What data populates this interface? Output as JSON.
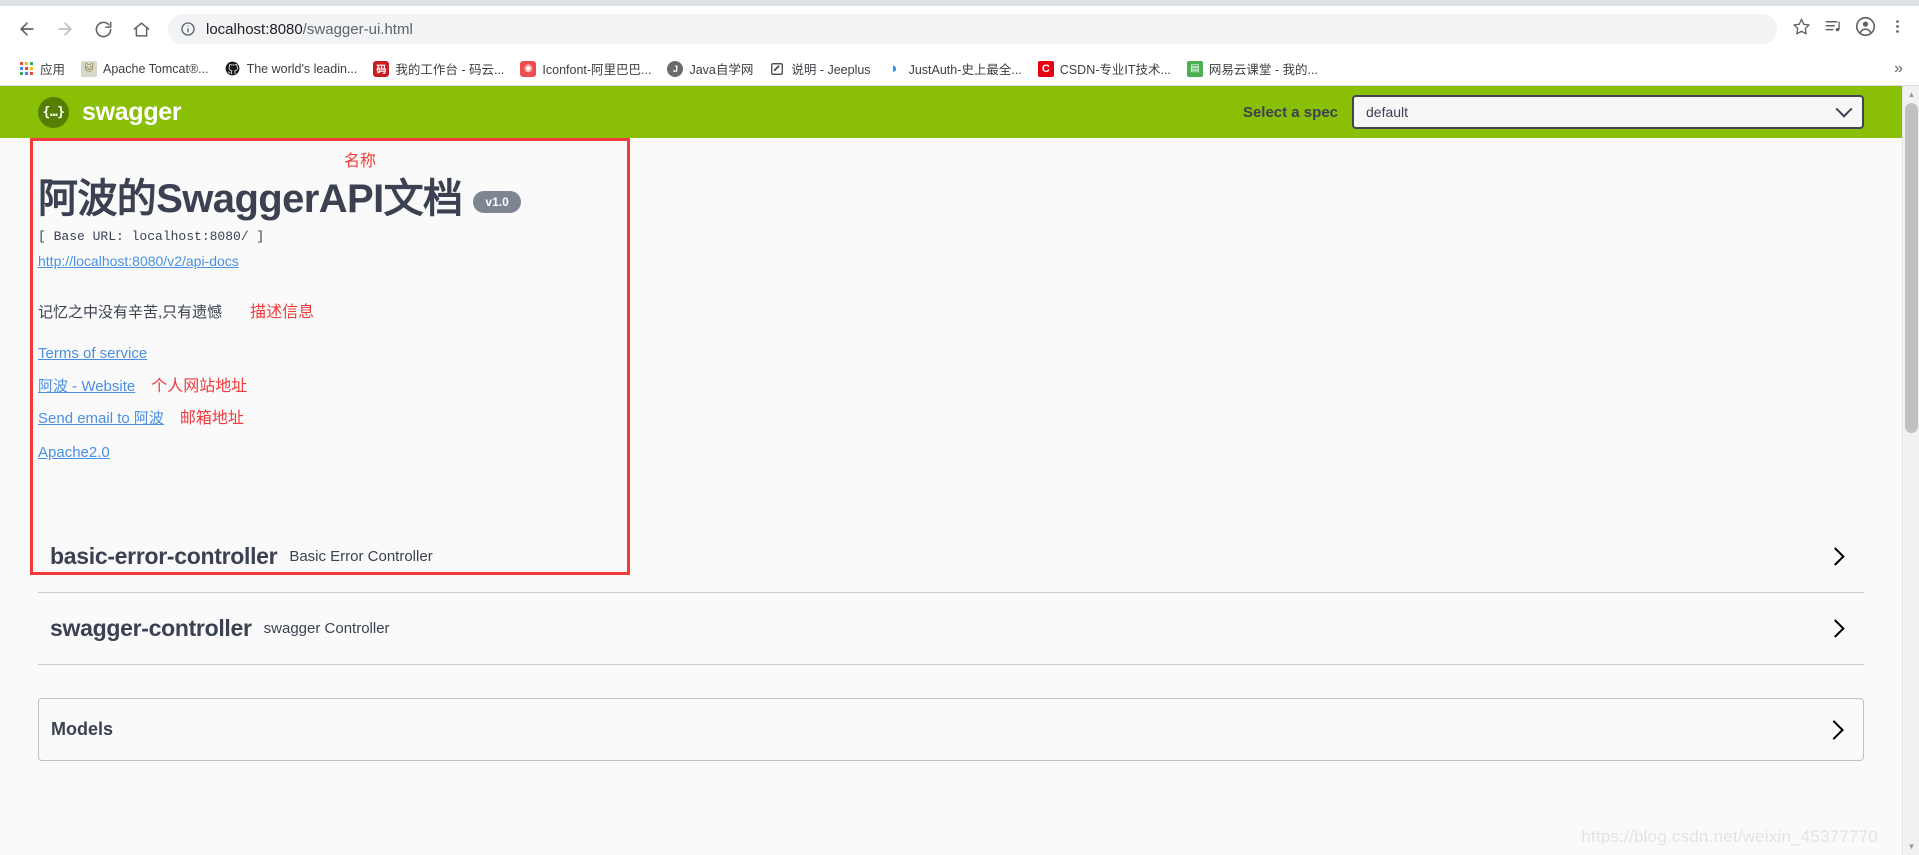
{
  "browser": {
    "back_icon": "back-arrow-icon",
    "forward_icon": "forward-arrow-icon",
    "reload_icon": "reload-icon",
    "home_icon": "home-icon",
    "url_host": "localhost:8080",
    "url_path": "/swagger-ui.html",
    "url_full": "localhost:8080/swagger-ui.html",
    "site_info_icon": "site-info-icon",
    "star_icon": "bookmark-star-icon",
    "media_icon": "media-playlist-icon",
    "profile_icon": "profile-avatar-icon",
    "menu_icon": "three-dot-menu-icon",
    "bookmarks": [
      {
        "label": "应用",
        "icon": "apps-grid-icon",
        "color": "#4285f4"
      },
      {
        "label": "Apache Tomcat®...",
        "icon": "tomcat-icon",
        "color": "#b0b0a0"
      },
      {
        "label": "The world's leadin...",
        "icon": "github-icon",
        "color": "#181717"
      },
      {
        "label": "我的工作台 - 码云...",
        "icon": "gitee-icon",
        "color": "#c71d23"
      },
      {
        "label": "Iconfont-阿里巴巴...",
        "icon": "iconfont-icon",
        "color": "#ee4c50"
      },
      {
        "label": "Java自学网",
        "icon": "java-icon",
        "color": "#5a5a5a"
      },
      {
        "label": "说明 - Jeeplus",
        "icon": "note-edit-icon",
        "color": "#333333"
      },
      {
        "label": "JustAuth-史上最全...",
        "icon": "justauth-icon",
        "color": "#2196f3"
      },
      {
        "label": "CSDN-专业IT技术...",
        "icon": "csdn-icon",
        "color": "#e60012"
      },
      {
        "label": "网易云课堂 - 我的...",
        "icon": "netease-icon",
        "color": "#4caf50"
      }
    ],
    "bookmarks_overflow": "»"
  },
  "swagger": {
    "logo_text": "swagger",
    "logo_glyph": "{…}",
    "spec_label": "Select a spec",
    "spec_selected": "default",
    "spec_chevron_icon": "chevron-down-icon",
    "title": "阿波的SwaggerAPI文档",
    "version": "v1.0",
    "base_url": "[ Base URL: localhost:8080/ ]",
    "api_docs_link": "http://localhost:8080/v2/api-docs",
    "description": "记忆之中没有辛苦,只有遗憾",
    "terms_link": "Terms of service",
    "website_link": "阿波 - Website",
    "email_link": "Send email to 阿波",
    "license_link": "Apache2.0",
    "annotations": {
      "name": "名称",
      "description": "描述信息",
      "website": "个人网站地址",
      "email": "邮箱地址",
      "box_color": "#ef3b3b"
    },
    "tags": [
      {
        "name": "basic-error-controller",
        "description": "Basic Error Controller",
        "chevron_icon": "chevron-right-icon"
      },
      {
        "name": "swagger-controller",
        "description": "swagger Controller",
        "chevron_icon": "chevron-right-icon"
      }
    ],
    "models_title": "Models",
    "models_chevron_icon": "chevron-right-icon",
    "brand_green": "#89bf04",
    "link_blue": "#4990e2"
  },
  "watermark": "https://blog.csdn.net/weixin_45377770",
  "scrollbar": {
    "up_icon": "scroll-up-arrow-icon",
    "down_icon": "scroll-down-arrow-icon"
  }
}
